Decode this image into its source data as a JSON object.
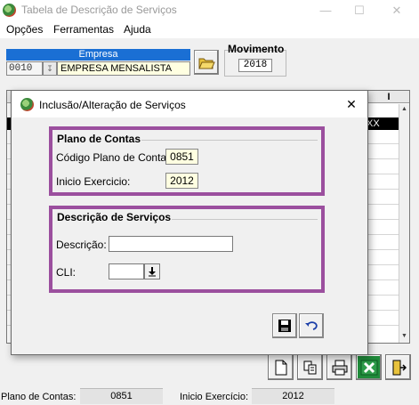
{
  "window": {
    "title": "Tabela de Descrição de Serviços",
    "icon": "app-globe-icon"
  },
  "menu": {
    "items": [
      "Opções",
      "Ferramentas",
      "Ajuda"
    ]
  },
  "empresa": {
    "header": "Empresa",
    "code": "0010",
    "name": "EMPRESA MENSALISTA"
  },
  "movimento": {
    "label": "Movimento",
    "value": "2018"
  },
  "grid": {
    "header_fragment": "I",
    "selected_fragment": "XX"
  },
  "dialog": {
    "title": "Inclusão/Alteração de Serviços",
    "plano_group": {
      "title": "Plano de Contas",
      "codigo_label": "Código Plano de Contas:",
      "codigo_value": "0851",
      "exercicio_label": "Inicio Exercicio:",
      "exercicio_value": "2012"
    },
    "servicos_group": {
      "title": "Descrição de Serviços",
      "descricao_label": "Descrição:",
      "descricao_value": "",
      "cli_label": "CLI:",
      "cli_value": ""
    }
  },
  "status": {
    "plano_label": "Plano de Contas:",
    "plano_value": "0851",
    "exercicio_label": "Inicio Exercício:",
    "exercicio_value": "2012"
  },
  "colors": {
    "group_border": "#9b4f9e",
    "empresa_header": "#1a6fd4",
    "readonly_field": "#ffffe1"
  }
}
